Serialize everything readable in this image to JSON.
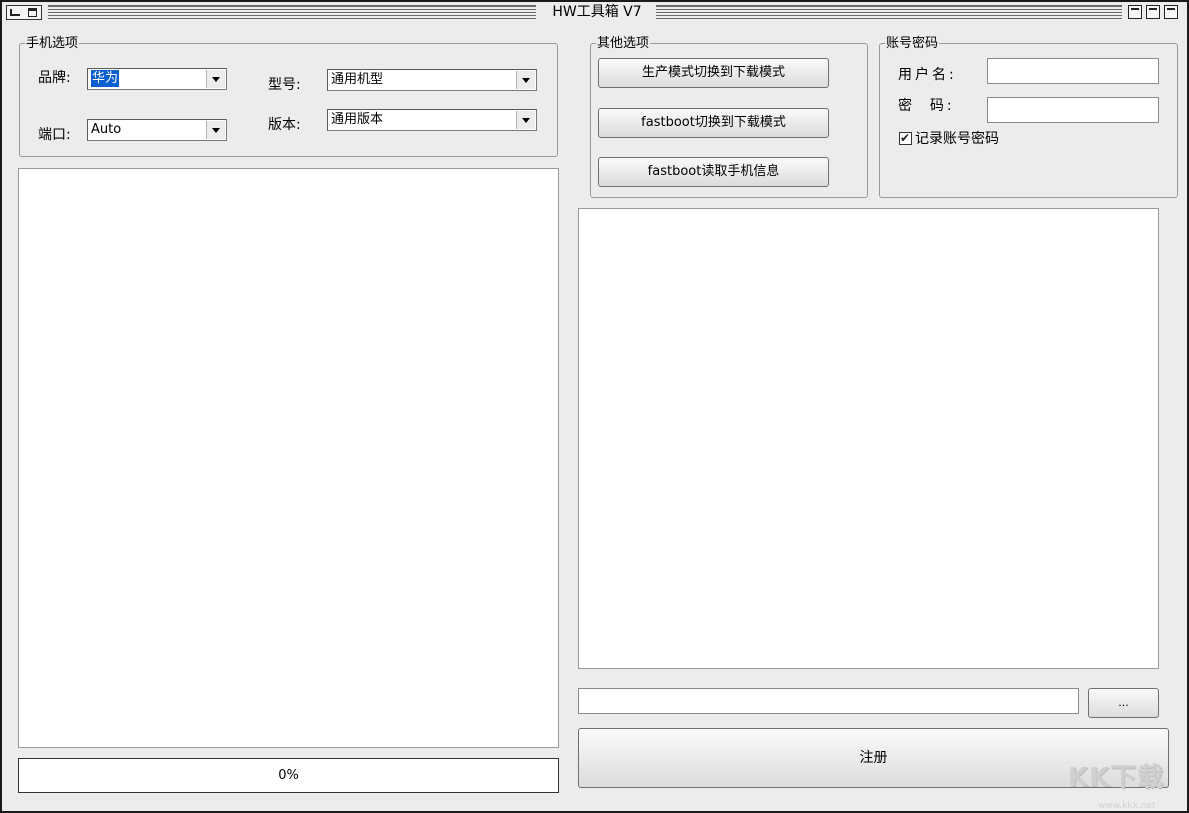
{
  "window": {
    "title": "HW工具箱 V7"
  },
  "phone_options": {
    "group_label": "手机选项",
    "brand_label": "品牌:",
    "brand_value": "华为",
    "model_label": "型号:",
    "model_value": "通用机型",
    "port_label": "端口:",
    "port_value": "Auto",
    "version_label": "版本:",
    "version_value": "通用版本"
  },
  "other_options": {
    "group_label": "其他选项",
    "btn_factory_to_download": "生产模式切换到下载模式",
    "btn_fastboot_to_download": "fastboot切换到下载模式",
    "btn_fastboot_read_info": "fastboot读取手机信息"
  },
  "account": {
    "group_label": "账号密码",
    "username_label": "用户名:",
    "username_value": "",
    "password_label": "密  码:",
    "password_value": "",
    "remember_label": "记录账号密码",
    "remember_checked": true
  },
  "progress": {
    "text": "0%",
    "value": 0
  },
  "file": {
    "path": "",
    "browse_label": "..."
  },
  "register": {
    "label": "注册"
  },
  "watermark": {
    "text": "KK下载",
    "sub": "www.kkx.net"
  }
}
